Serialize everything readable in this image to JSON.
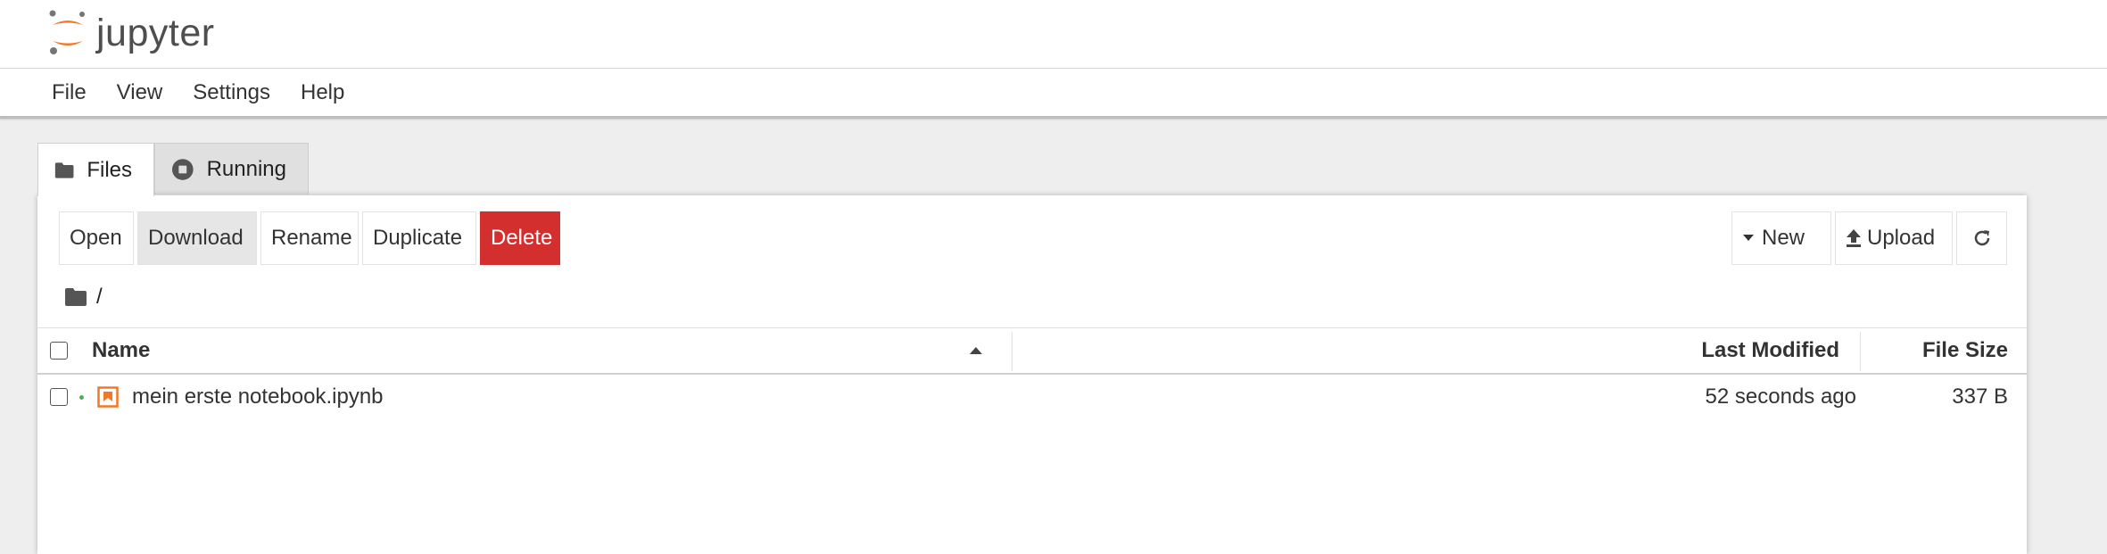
{
  "app": {
    "logo_text": "jupyter"
  },
  "menu": [
    "File",
    "View",
    "Settings",
    "Help"
  ],
  "tabs": [
    {
      "label": "Files",
      "icon": "folder-icon",
      "active": true
    },
    {
      "label": "Running",
      "icon": "stop-circle-icon",
      "active": false
    }
  ],
  "toolbar": {
    "open": "Open",
    "download": "Download",
    "rename": "Rename",
    "duplicate": "Duplicate",
    "delete": "Delete",
    "new": "New",
    "upload": "Upload"
  },
  "breadcrumb": {
    "path": "/"
  },
  "table": {
    "headers": {
      "name": "Name",
      "last_modified": "Last Modified",
      "file_size": "File Size"
    },
    "sort": "ascending",
    "rows": [
      {
        "name": "mein erste notebook.ipynb",
        "last_modified": "52 seconds ago",
        "file_size": "337 B",
        "running": true
      }
    ]
  },
  "colors": {
    "accent_orange": "#f37726",
    "delete_red": "#d32f2f",
    "running_dot": "#4caf50"
  }
}
